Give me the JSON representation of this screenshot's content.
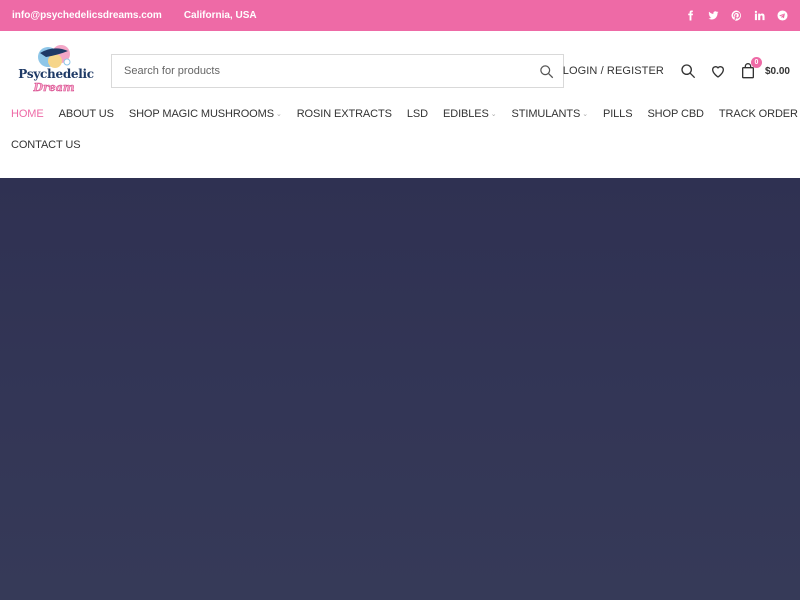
{
  "topbar": {
    "email": "info@psychedelicsdreams.com",
    "location": "California, USA",
    "social": [
      "facebook-icon",
      "twitter-icon",
      "pinterest-icon",
      "linkedin-icon",
      "telegram-icon"
    ],
    "bg_color": "#ee6aa6"
  },
  "logo": {
    "line1": "Psychedelic",
    "line2": "Dream"
  },
  "search": {
    "placeholder": "Search for products"
  },
  "header": {
    "login_label": "LOGIN / REGISTER",
    "cart_count": "0",
    "cart_total": "$0.00"
  },
  "nav": {
    "items": [
      {
        "label": "HOME",
        "active": true
      },
      {
        "label": "ABOUT US"
      },
      {
        "label": "SHOP MAGIC MUSHROOMS",
        "dropdown": true
      },
      {
        "label": "ROSIN EXTRACTS"
      },
      {
        "label": "LSD"
      },
      {
        "label": "EDIBLES",
        "dropdown": true
      },
      {
        "label": "STIMULANTS",
        "dropdown": true
      },
      {
        "label": "PILLS"
      },
      {
        "label": "SHOP CBD"
      },
      {
        "label": "TRACK ORDER"
      },
      {
        "label": "CONTACT US"
      }
    ],
    "accent_color": "#ee6aa6"
  },
  "hero": {
    "bg_color": "#333656"
  }
}
